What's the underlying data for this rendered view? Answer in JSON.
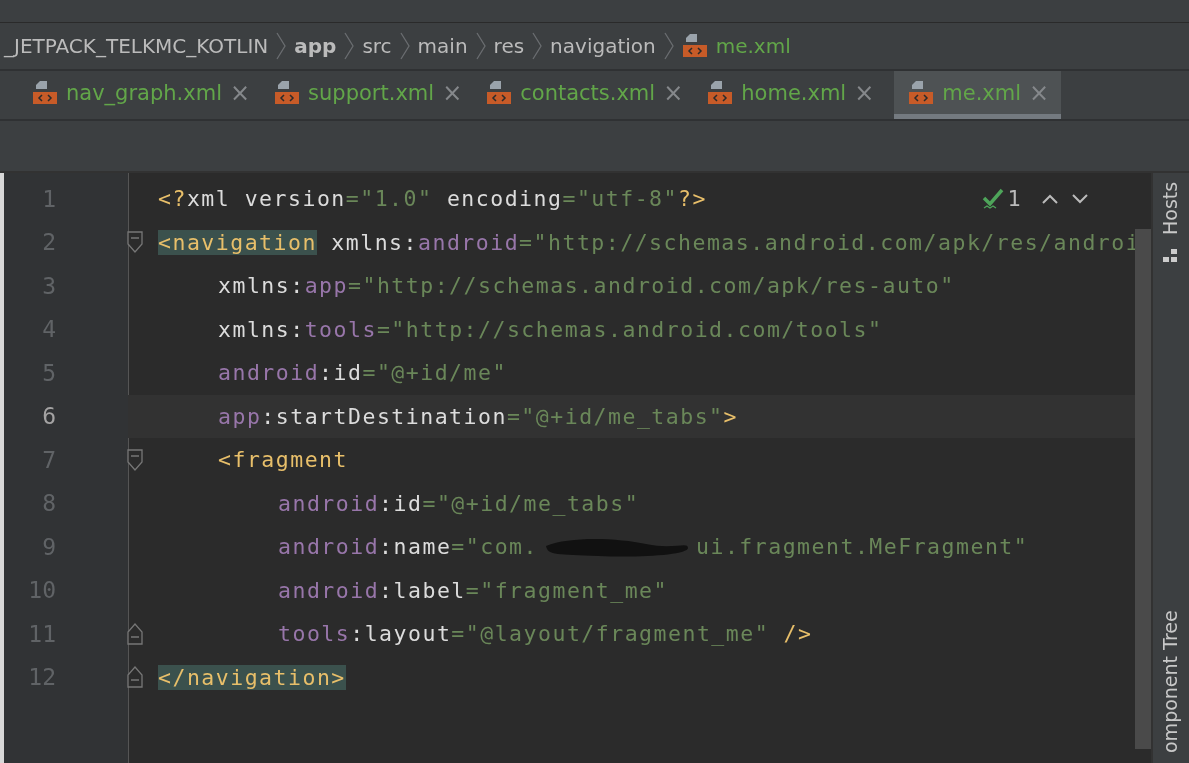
{
  "breadcrumbs": [
    {
      "label": "_JETPACK_TELKMC_KOTLIN",
      "bold": false,
      "file": false
    },
    {
      "label": "app",
      "bold": true,
      "file": false
    },
    {
      "label": "src",
      "bold": false,
      "file": false
    },
    {
      "label": "main",
      "bold": false,
      "file": false
    },
    {
      "label": "res",
      "bold": false,
      "file": false
    },
    {
      "label": "navigation",
      "bold": false,
      "file": false
    },
    {
      "label": "me.xml",
      "bold": false,
      "file": true
    }
  ],
  "tabs": [
    {
      "label": "nav_graph.xml",
      "close": "×",
      "selected": false
    },
    {
      "label": "support.xml",
      "close": "×",
      "selected": false
    },
    {
      "label": "contacts.xml",
      "close": "×",
      "selected": false
    },
    {
      "label": "home.xml",
      "close": "×",
      "selected": false
    },
    {
      "label": "me.xml",
      "close": "×",
      "selected": true
    }
  ],
  "inspection": {
    "count": "1"
  },
  "editor": {
    "lines": [
      {
        "number": "1",
        "current": false,
        "fold_start": false,
        "fold_end": false,
        "tokens": [
          {
            "kind": "tag",
            "t": "<?"
          },
          {
            "kind": "plain",
            "t": "xml version"
          },
          {
            "kind": "str",
            "t": "=\"1.0\""
          },
          {
            "kind": "plain",
            "t": " encoding"
          },
          {
            "kind": "str",
            "t": "=\"utf-8\""
          },
          {
            "kind": "tag",
            "t": "?>"
          }
        ]
      },
      {
        "number": "2",
        "current": false,
        "fold_start": true,
        "fold_end": false,
        "tokens": [
          {
            "kind": "taghl",
            "t": "<navigation"
          },
          {
            "kind": "plain",
            "t": " xmlns:"
          },
          {
            "kind": "ns",
            "t": "android"
          },
          {
            "kind": "str",
            "t": "=\"http://schemas.android.com/apk/res/androi"
          }
        ],
        "children": [
          {
            "number": "3",
            "current": false,
            "fold_start": false,
            "fold_end": false,
            "tokens": [
              {
                "kind": "plain",
                "t": "xmlns:"
              },
              {
                "kind": "ns",
                "t": "app"
              },
              {
                "kind": "str",
                "t": "=\"http://schemas.android.com/apk/res-auto\""
              }
            ]
          },
          {
            "number": "4",
            "current": false,
            "fold_start": false,
            "fold_end": false,
            "tokens": [
              {
                "kind": "plain",
                "t": "xmlns:"
              },
              {
                "kind": "ns",
                "t": "tools"
              },
              {
                "kind": "str",
                "t": "=\"http://schemas.android.com/tools\""
              }
            ]
          },
          {
            "number": "5",
            "current": false,
            "fold_start": false,
            "fold_end": false,
            "tokens": [
              {
                "kind": "ns",
                "t": "android"
              },
              {
                "kind": "plain",
                "t": ":id"
              },
              {
                "kind": "str",
                "t": "=\"@+id/me\""
              }
            ]
          },
          {
            "number": "6",
            "current": true,
            "fold_start": false,
            "fold_end": false,
            "tokens": [
              {
                "kind": "ns",
                "t": "app"
              },
              {
                "kind": "plain",
                "t": ":startDestination"
              },
              {
                "kind": "str",
                "t": "=\"@+id/me_tabs\""
              },
              {
                "kind": "tag",
                "t": ">"
              }
            ]
          },
          {
            "number": "7",
            "current": false,
            "fold_start": true,
            "fold_end": false,
            "tokens": [
              {
                "kind": "tag",
                "t": "<fragment"
              }
            ],
            "children": [
              {
                "number": "8",
                "current": false,
                "fold_start": false,
                "fold_end": false,
                "tokens": [
                  {
                    "kind": "ns",
                    "t": "android"
                  },
                  {
                    "kind": "plain",
                    "t": ":id"
                  },
                  {
                    "kind": "str",
                    "t": "=\"@+id/me_tabs\""
                  }
                ]
              },
              {
                "number": "9",
                "current": false,
                "fold_start": false,
                "fold_end": false,
                "tokens": [
                  {
                    "kind": "ns",
                    "t": "android"
                  },
                  {
                    "kind": "plain",
                    "t": ":name"
                  },
                  {
                    "kind": "str",
                    "t": "=\"com."
                  },
                  {
                    "kind": "redaction"
                  },
                  {
                    "kind": "str",
                    "t": "ui.fragment.MeFragment\""
                  }
                ]
              },
              {
                "number": "10",
                "current": false,
                "fold_start": false,
                "fold_end": false,
                "tokens": [
                  {
                    "kind": "ns",
                    "t": "android"
                  },
                  {
                    "kind": "plain",
                    "t": ":label"
                  },
                  {
                    "kind": "str",
                    "t": "=\"fragment_me\""
                  }
                ]
              },
              {
                "number": "11",
                "current": false,
                "fold_start": false,
                "fold_end": true,
                "tokens": [
                  {
                    "kind": "ns",
                    "t": "tools"
                  },
                  {
                    "kind": "plain",
                    "t": ":layout"
                  },
                  {
                    "kind": "str",
                    "t": "=\"@layout/fragment_me\""
                  },
                  {
                    "kind": "tag",
                    "t": " />"
                  }
                ]
              }
            ]
          }
        ]
      },
      {
        "number": "12",
        "current": false,
        "fold_start": false,
        "fold_end": true,
        "tokens": [
          {
            "kind": "taghl",
            "t": "</navigation>"
          }
        ]
      }
    ]
  },
  "side_panel": {
    "top": "Hosts",
    "bottom": "omponent Tree"
  }
}
